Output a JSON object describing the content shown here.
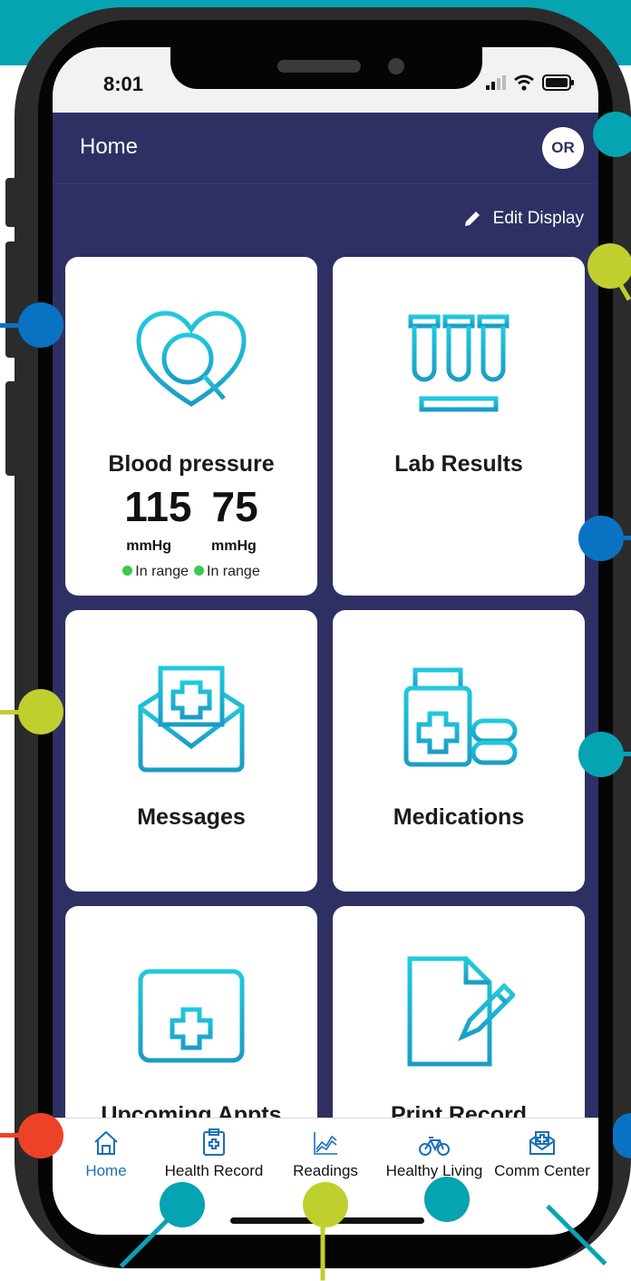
{
  "status_bar": {
    "time": "8:01"
  },
  "header": {
    "title": "Home",
    "avatar_initials": "OR"
  },
  "edit_display": {
    "label": "Edit Display"
  },
  "cards": {
    "blood_pressure": {
      "title": "Blood pressure",
      "systolic": "115",
      "diastolic": "75",
      "systolic_unit": "mmHg",
      "diastolic_unit": "mmHg",
      "systolic_status": "In range",
      "diastolic_status": "In range"
    },
    "lab_results": {
      "title": "Lab Results"
    },
    "messages": {
      "title": "Messages"
    },
    "medications": {
      "title": "Medications"
    },
    "upcoming_appts": {
      "title": "Upcoming Appts"
    },
    "print_record": {
      "title": "Print Record"
    }
  },
  "tabs": [
    {
      "label": "Home",
      "icon": "home-icon",
      "active": true
    },
    {
      "label": "Health Record",
      "icon": "clipboard-icon"
    },
    {
      "label": "Readings",
      "icon": "chart-icon"
    },
    {
      "label": "Healthy Living",
      "icon": "bicycle-icon"
    },
    {
      "label": "Comm Center",
      "icon": "medical-envelope-icon"
    }
  ],
  "colors": {
    "teal": "#06a3b3",
    "navy": "#2e3063",
    "lime": "#bfcf2e",
    "blue": "#0a72c2",
    "red": "#ee4228",
    "icon_gradient_start": "#1ec8dc",
    "icon_gradient_end": "#1a9fc7",
    "active_tab": "#1b6fb8",
    "in_range": "#3cc94d"
  }
}
